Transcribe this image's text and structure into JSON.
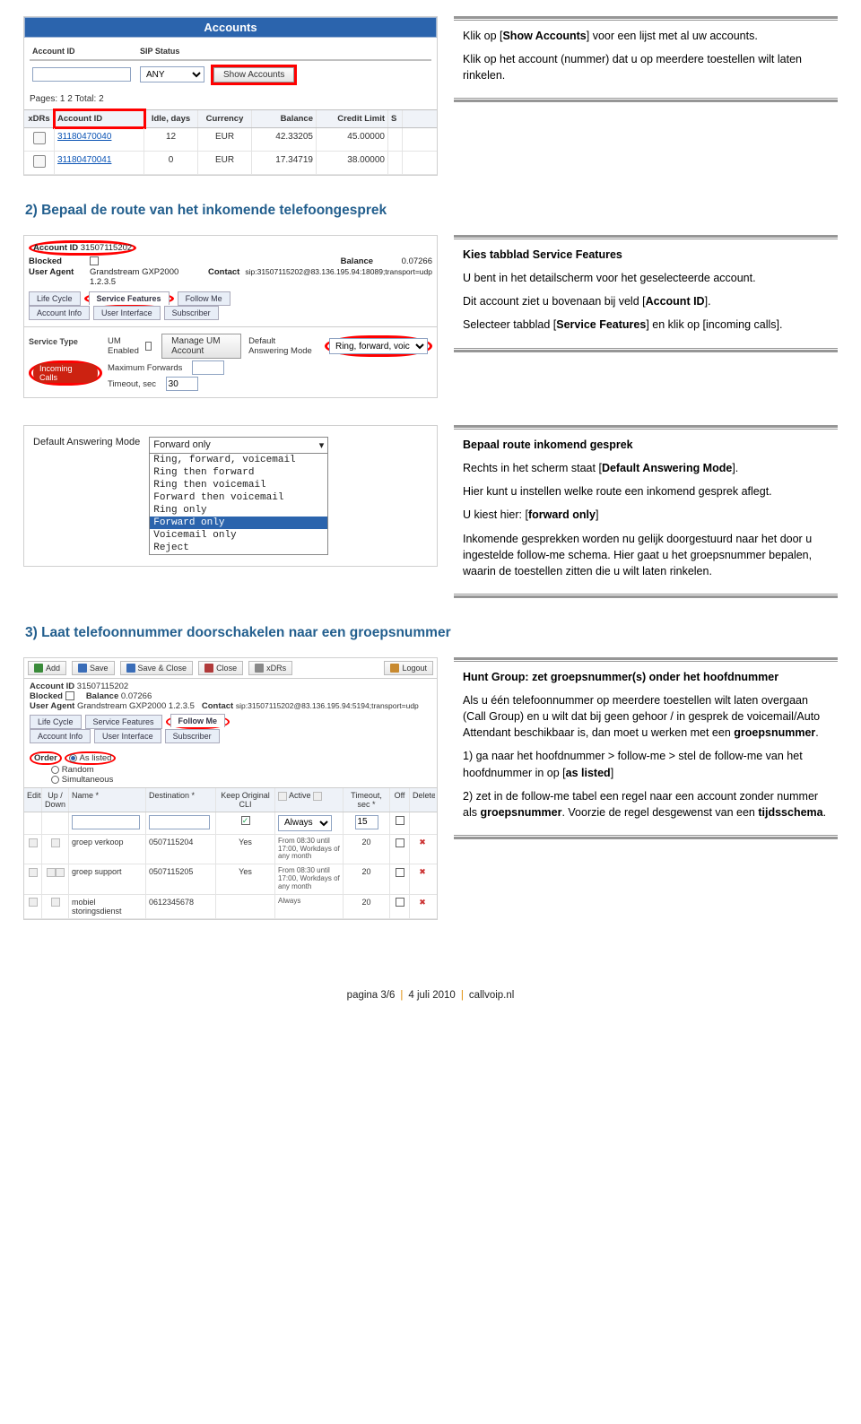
{
  "section1": {
    "p1a": "Klik op [",
    "p1b": "Show Accounts",
    "p1c": "] voor een lijst met al uw accounts.",
    "p2": "Klik op het account (nummer) dat u op meerdere toestellen wilt laten rinkelen."
  },
  "accounts": {
    "title": "Accounts",
    "hdr_id": "Account ID",
    "hdr_sip": "SIP Status",
    "any": "ANY",
    "show_btn": "Show Accounts",
    "pages": "Pages: 1 2   Total: 2",
    "cols": {
      "xdrs": "xDRs",
      "acc": "Account ID",
      "idle": "Idle, days",
      "cur": "Currency",
      "bal": "Balance",
      "cred": "Credit Limit",
      "s": "S"
    },
    "rows": [
      {
        "acc": "31180470040",
        "idle": "12",
        "cur": "EUR",
        "bal": "42.33205",
        "cred": "45.00000"
      },
      {
        "acc": "31180470041",
        "idle": "0",
        "cur": "EUR",
        "bal": "17.34719",
        "cred": "38.00000"
      }
    ]
  },
  "section2": {
    "title": "2) Bepaal de route van het inkomende telefoongesprek",
    "p1a": "Kies tabblad Service Features",
    "p1": "U bent in het detailscherm voor het geselecteerde account.",
    "p2a": "Dit account ziet u bovenaan bij veld [",
    "p2b": "Account ID",
    "p2c": "].",
    "p3a": "Selecteer tabblad [",
    "p3b": "Service Features",
    "p3c": "] en klik op [incoming calls]."
  },
  "sf": {
    "accid_lbl": "Account ID",
    "accid": "31507115202",
    "blocked_lbl": "Blocked",
    "balance_lbl": "Balance",
    "balance": "0.07266",
    "ua_lbl": "User Agent",
    "ua": "Grandstream GXP2000 1.2.3.5",
    "contact_lbl": "Contact",
    "contact": "sip:31507115202@83.136.195.94:18089;transport=udp",
    "tabs": [
      "Life Cycle",
      "Service Features",
      "Follow Me"
    ],
    "subtabs": [
      "Account Info",
      "User Interface",
      "Subscriber"
    ],
    "st_lbl": "Service Type",
    "incoming": "Incoming Calls",
    "um": "UM Enabled",
    "manage": "Manage UM Account",
    "dam": "Default Answering Mode",
    "dam_val": "Ring, forward, voic",
    "maxfw": "Maximum Forwards",
    "tout": "Timeout, sec",
    "tout_val": "30"
  },
  "dam": {
    "label": "Default Answering Mode",
    "selected": "Forward only",
    "options": [
      "Ring, forward, voicemail",
      "Ring then forward",
      "Ring then voicemail",
      "Forward then voicemail",
      "Ring only",
      "Forward only",
      "Voicemail only",
      "Reject"
    ]
  },
  "section3txt": {
    "h": "Bepaal route inkomend gesprek",
    "p1a": "Rechts in het scherm staat [",
    "p1b": "Default Answering Mode",
    "p1c": "].",
    "p2": "Hier kunt u instellen welke route een inkomend gesprek aflegt.",
    "p3a": "U kiest hier: [",
    "p3b": "forward only",
    "p3c": "]",
    "p4": "Inkomende gesprekken worden nu gelijk doorgestuurd naar het door u ingestelde follow-me schema. Hier gaat u het groepsnummer bepalen, waarin de toestellen zitten die u wilt laten rinkelen."
  },
  "section4": {
    "title": "3) Laat telefoonnummer doorschakelen naar een groepsnummer",
    "h": "Hunt Group: zet groepsnummer(s) onder het hoofdnummer",
    "p1a": "Als u één telefoonnummer op meerdere toestellen wilt laten overgaan (Call Group) en u wilt dat bij geen gehoor / in gesprek de voicemail/Auto Attendant beschikbaar is, dan moet u werken met een ",
    "p1b": "groepsnummer",
    "p1c": ".",
    "p2a": "1) ga naar het hoofdnummer > follow-me > stel de follow-me van het hoofdnummer in op [",
    "p2b": "as listed",
    "p2c": "]",
    "p3a": "2) zet in de follow-me tabel een regel naar een account zonder nummer als ",
    "p3b": "groepsnummer",
    "p3c": ". Voorzie de regel desgewenst van een ",
    "p3d": "tijdsschema",
    "p3e": "."
  },
  "fm": {
    "toolbar": {
      "add": "Add",
      "save": "Save",
      "saveclose": "Save & Close",
      "close": "Close",
      "xdrs": "xDRs",
      "logout": "Logout"
    },
    "accid_lbl": "Account ID",
    "accid": "31507115202",
    "blocked_lbl": "Blocked",
    "balance_lbl": "Balance",
    "balance": "0.07266",
    "ua_lbl": "User Agent",
    "ua": "Grandstream GXP2000 1.2.3.5",
    "contact_lbl": "Contact",
    "contact": "sip:31507115202@83.136.195.94:5194;transport=udp",
    "tabs": [
      "Life Cycle",
      "Service Features",
      "Follow Me"
    ],
    "subtabs": [
      "Account Info",
      "User Interface",
      "Subscriber"
    ],
    "order_lbl": "Order",
    "order": [
      "As listed",
      "Random",
      "Simultaneous"
    ],
    "cols": {
      "edit": "Edit",
      "ud": "Up / Down",
      "name": "Name",
      "dest": "Destination",
      "kcli": "Keep Original CLI",
      "active": "Active",
      "timeout": "Timeout, sec",
      "off": "Off",
      "del": "Delete"
    },
    "blankrow": {
      "timeout": "15"
    },
    "rows": [
      {
        "name": "groep verkoop",
        "dest": "0507115204",
        "kcli": "Yes",
        "active": "From 08:30 until 17:00, Workdays of any month",
        "timeout": "20"
      },
      {
        "name": "groep support",
        "dest": "0507115205",
        "kcli": "Yes",
        "active": "From 08:30 until 17:00, Workdays of any month",
        "timeout": "20"
      },
      {
        "name": "mobiel storingsdienst",
        "dest": "0612345678",
        "kcli": "",
        "active": "Always",
        "timeout": "20"
      }
    ]
  },
  "footer": {
    "p": "pagina 3/6",
    "d": "4 juli 2010",
    "s": "callvoip.nl"
  }
}
